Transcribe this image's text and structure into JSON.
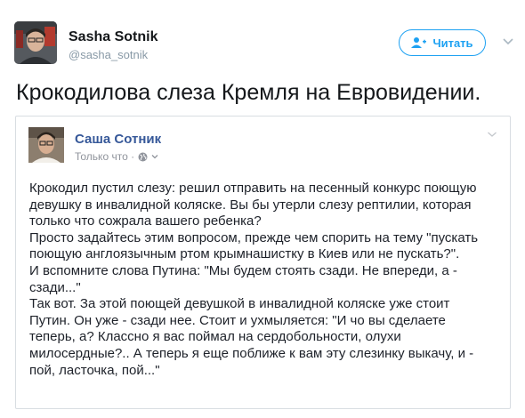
{
  "tweet": {
    "author_name": "Sasha Sotnik",
    "author_handle": "@sasha_sotnik",
    "follow_label": "Читать",
    "text": "Крокодилова слеза Кремля на Евровидении."
  },
  "quote": {
    "author_name": "Саша Сотник",
    "meta": "Только что ·",
    "lines": [
      "Крокодил пустил слезу: решил отправить на песенный конкурс поющую",
      "девушку в инвалидной коляске. Вы бы утерли слезу рептилии, которая",
      "только что сожрала вашего ребенка?",
      "Просто задайтесь этим вопросом, прежде чем спорить на тему \"пускать",
      "поющую англоязычным ртом крымнашистку в Киев или не пускать?\".",
      "И вспомните слова Путина: \"Мы будем стоять сзади. Не впереди, а -",
      "сзади...\"",
      "Так вот. За этой поющей девушкой в инвалидной коляске уже стоит",
      "Путин. Он уже - сзади нее. Стоит и ухмыляется: \"И чо вы сделаете",
      "теперь, а? Классно я вас поймал на сердобольности, олухи",
      "милосердные?.. А теперь я еще поближе к вам эту слезинку выкачу, и -",
      "пой, ласточка, пой...\""
    ]
  },
  "colors": {
    "twitter_blue": "#1da1f2",
    "facebook_link": "#365899",
    "muted": "#8899a6"
  }
}
